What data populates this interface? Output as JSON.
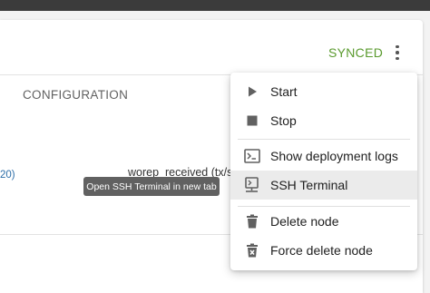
{
  "node": {
    "status": "SYNCED",
    "column_header": "CONFIGURATION",
    "link_fragment": "20)",
    "param_fragment": "worep_received (tx/s)"
  },
  "tooltip": {
    "text": "Open SSH Terminal in new tab"
  },
  "menu": {
    "items": [
      {
        "label": "Start",
        "icon": "play-icon"
      },
      {
        "label": "Stop",
        "icon": "stop-icon"
      },
      {
        "label": "Show deployment logs",
        "icon": "terminal-icon"
      },
      {
        "label": "SSH Terminal",
        "icon": "ssh-terminal-icon"
      },
      {
        "label": "Delete node",
        "icon": "trash-icon"
      },
      {
        "label": "Force delete node",
        "icon": "force-delete-icon"
      }
    ]
  },
  "colors": {
    "status_synced": "#5a9a2e",
    "link": "#2d6ea8",
    "tooltip_bg": "#616161",
    "menu_hover": "#ebebeb"
  }
}
